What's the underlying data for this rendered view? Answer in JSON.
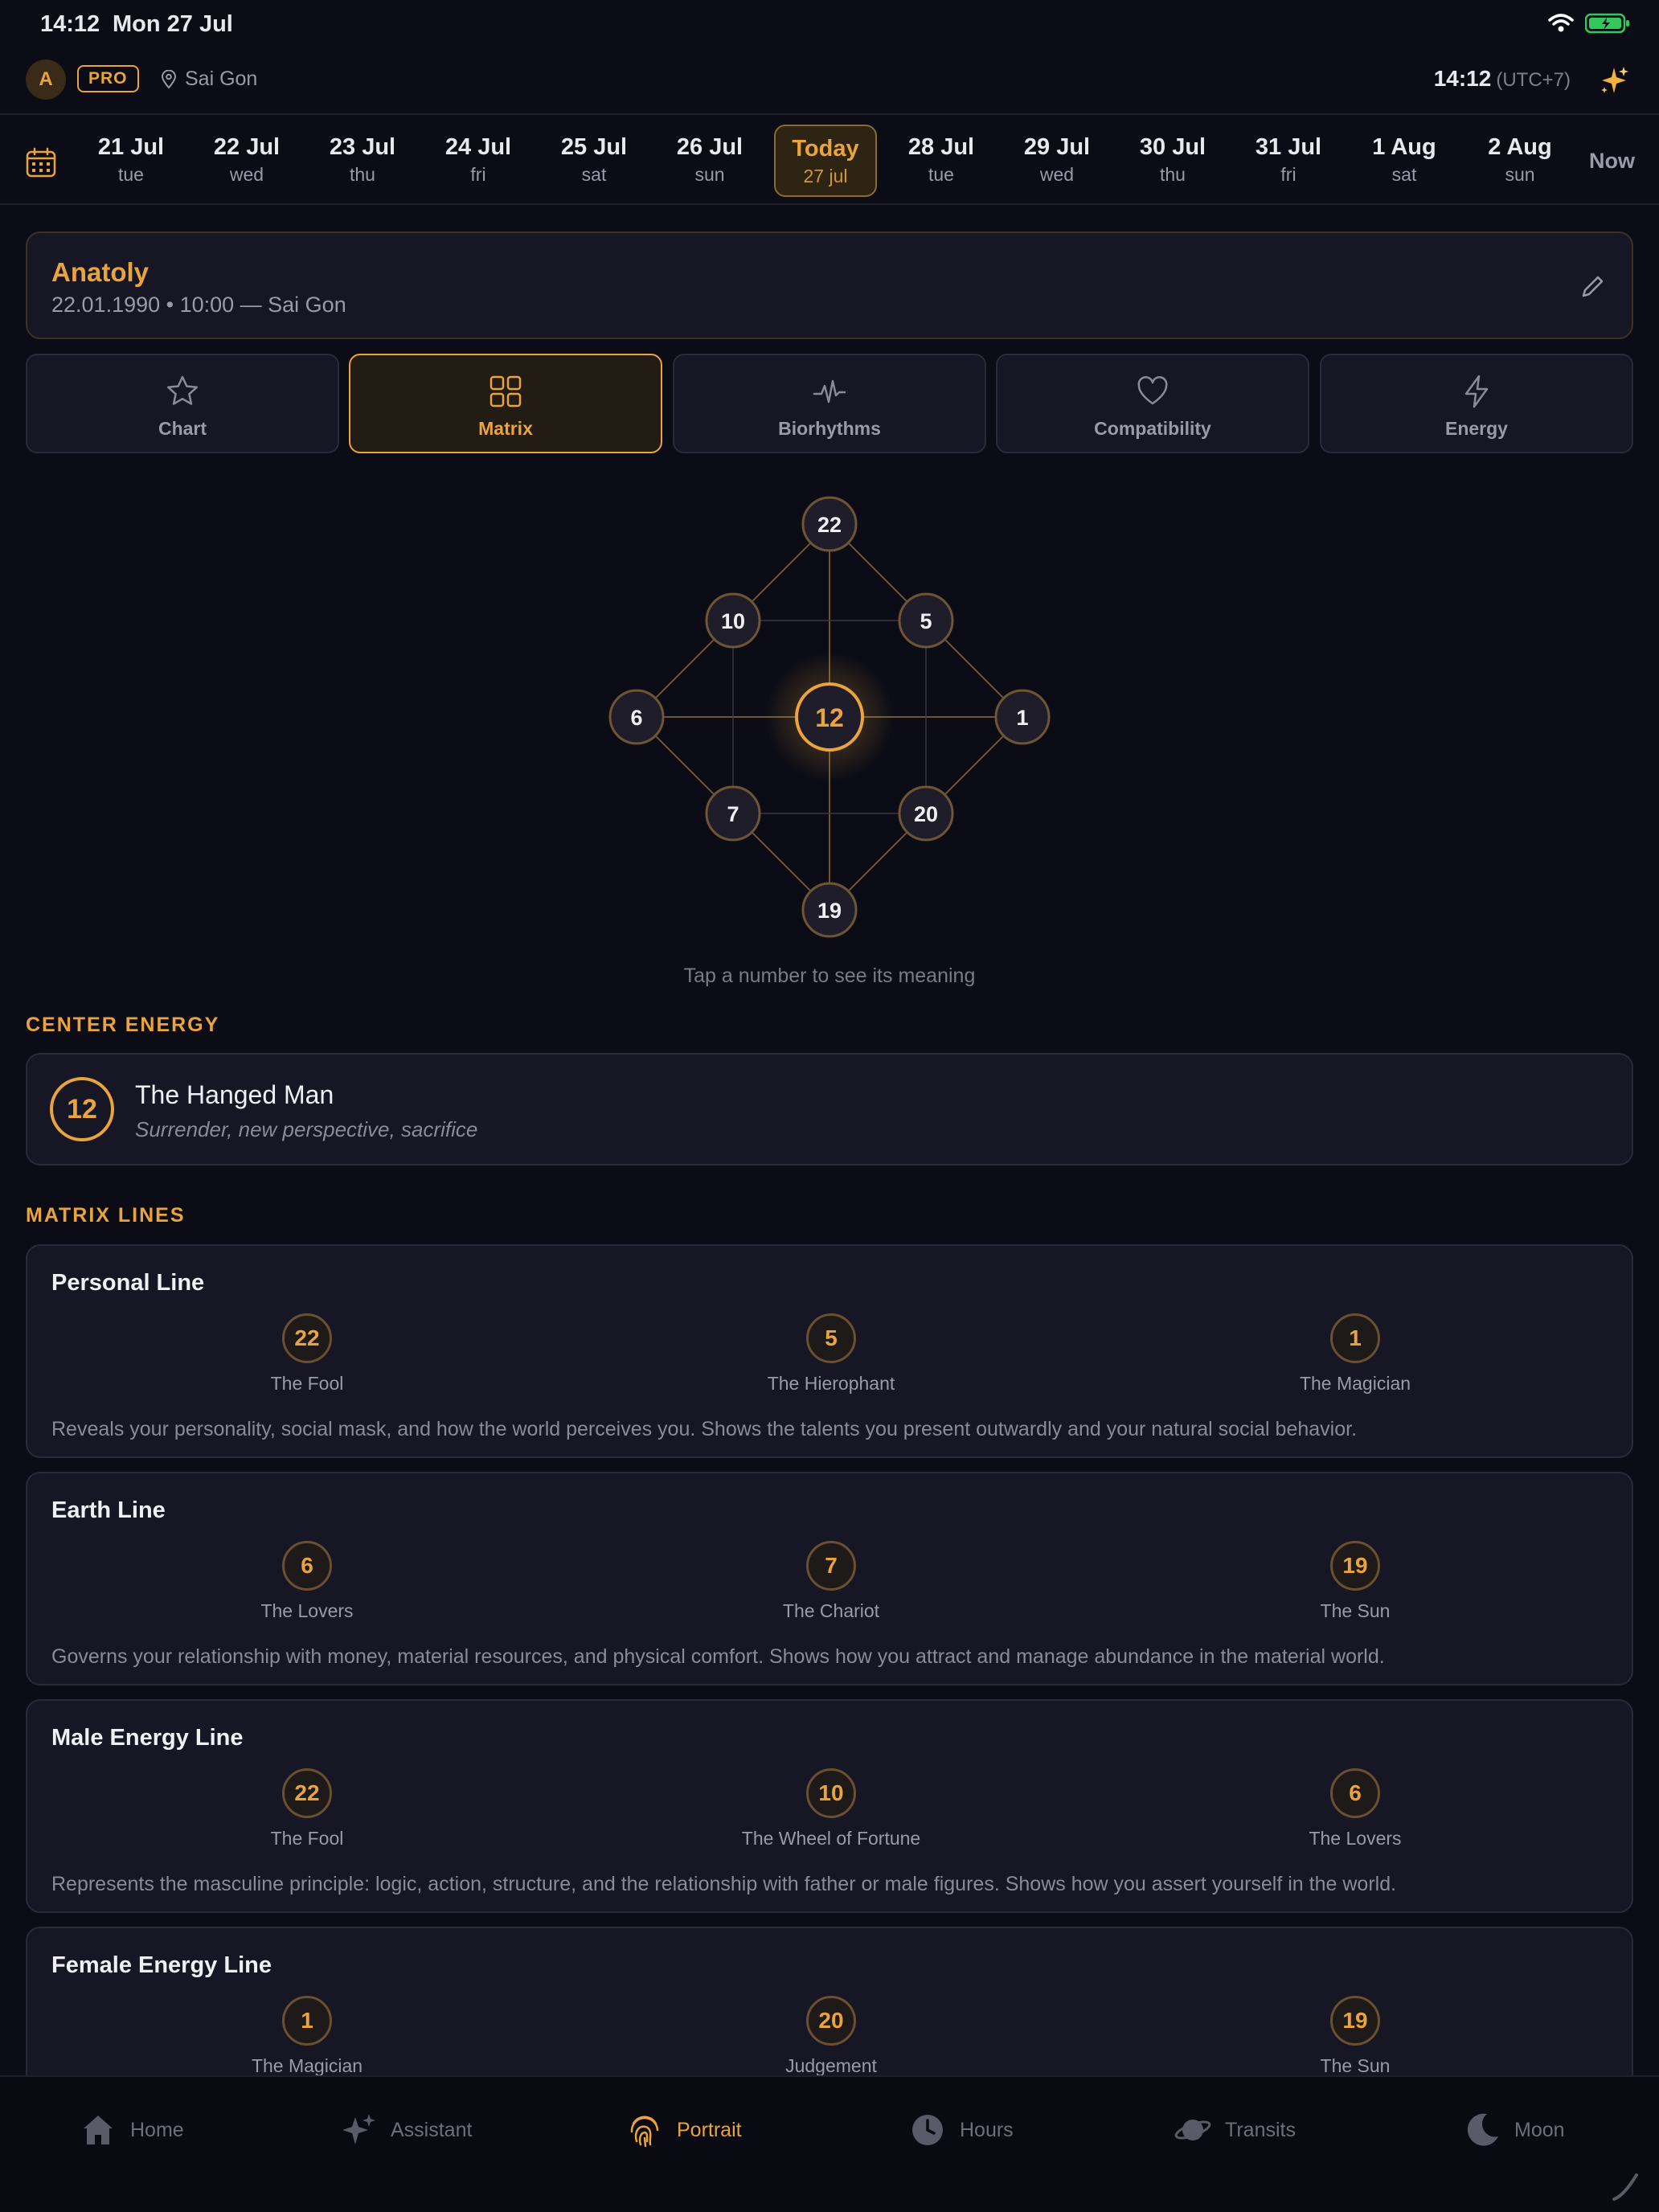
{
  "status": {
    "time": "14:12",
    "date": "Mon 27 Jul"
  },
  "header": {
    "avatar_initial": "A",
    "pro_label": "PRO",
    "location": "Sai Gon",
    "time": "14:12",
    "utc": "(UTC+7)"
  },
  "dates": {
    "days": [
      {
        "d1": "21 Jul",
        "d2": "tue"
      },
      {
        "d1": "22 Jul",
        "d2": "wed"
      },
      {
        "d1": "23 Jul",
        "d2": "thu"
      },
      {
        "d1": "24 Jul",
        "d2": "fri"
      },
      {
        "d1": "25 Jul",
        "d2": "sat"
      },
      {
        "d1": "26 Jul",
        "d2": "sun"
      },
      {
        "d1": "Today",
        "d2": "27 jul"
      },
      {
        "d1": "28 Jul",
        "d2": "tue"
      },
      {
        "d1": "29 Jul",
        "d2": "wed"
      },
      {
        "d1": "30 Jul",
        "d2": "thu"
      },
      {
        "d1": "31 Jul",
        "d2": "fri"
      },
      {
        "d1": "1 Aug",
        "d2": "sat"
      },
      {
        "d1": "2 Aug",
        "d2": "sun"
      }
    ],
    "now_label": "Now"
  },
  "profile": {
    "name": "Anatoly",
    "info": "22.01.1990 • 10:00 — Sai Gon"
  },
  "tabs": [
    {
      "label": "Chart",
      "icon": "star-icon"
    },
    {
      "label": "Matrix",
      "icon": "grid-icon"
    },
    {
      "label": "Biorhythms",
      "icon": "pulse-icon"
    },
    {
      "label": "Compatibility",
      "icon": "heart-icon"
    },
    {
      "label": "Energy",
      "icon": "lightning-icon"
    }
  ],
  "matrix": {
    "center": "12",
    "top": "22",
    "upper_left": "10",
    "upper_right": "5",
    "left": "6",
    "right": "1",
    "lower_left": "7",
    "lower_right": "20",
    "bottom": "19",
    "hint": "Tap a number to see its meaning"
  },
  "center_energy": {
    "section_title": "CENTER ENERGY",
    "number": "12",
    "title": "The Hanged Man",
    "subtitle": "Surrender, new perspective, sacrifice"
  },
  "matrix_lines": {
    "section_title": "MATRIX LINES",
    "lines": [
      {
        "title": "Personal Line",
        "arcana": [
          {
            "num": "22",
            "name": "The Fool"
          },
          {
            "num": "5",
            "name": "The Hierophant"
          },
          {
            "num": "1",
            "name": "The Magician"
          }
        ],
        "description": "Reveals your personality, social mask, and how the world perceives you. Shows the talents you present outwardly and your natural social behavior."
      },
      {
        "title": "Earth Line",
        "arcana": [
          {
            "num": "6",
            "name": "The Lovers"
          },
          {
            "num": "7",
            "name": "The Chariot"
          },
          {
            "num": "19",
            "name": "The Sun"
          }
        ],
        "description": "Governs your relationship with money, material resources, and physical comfort. Shows how you attract and manage abundance in the material world."
      },
      {
        "title": "Male Energy Line",
        "arcana": [
          {
            "num": "22",
            "name": "The Fool"
          },
          {
            "num": "10",
            "name": "The Wheel of Fortune"
          },
          {
            "num": "6",
            "name": "The Lovers"
          }
        ],
        "description": "Represents the masculine principle: logic, action, structure, and the relationship with father or male figures. Shows how you assert yourself in the world."
      },
      {
        "title": "Female Energy Line",
        "arcana": [
          {
            "num": "1",
            "name": "The Magician"
          },
          {
            "num": "20",
            "name": "Judgement"
          },
          {
            "num": "19",
            "name": "The Sun"
          }
        ],
        "description": ""
      }
    ]
  },
  "bottom_nav": [
    {
      "label": "Home",
      "icon": "home-icon"
    },
    {
      "label": "Assistant",
      "icon": "sparkles-icon"
    },
    {
      "label": "Portrait",
      "icon": "fingerprint-icon"
    },
    {
      "label": "Hours",
      "icon": "clock-icon"
    },
    {
      "label": "Transits",
      "icon": "planet-icon"
    },
    {
      "label": "Moon",
      "icon": "moon-icon"
    }
  ],
  "colors": {
    "accent": "#e9a43c",
    "background": "#0c0c16",
    "card": "#161624",
    "battery": "#34c759"
  }
}
